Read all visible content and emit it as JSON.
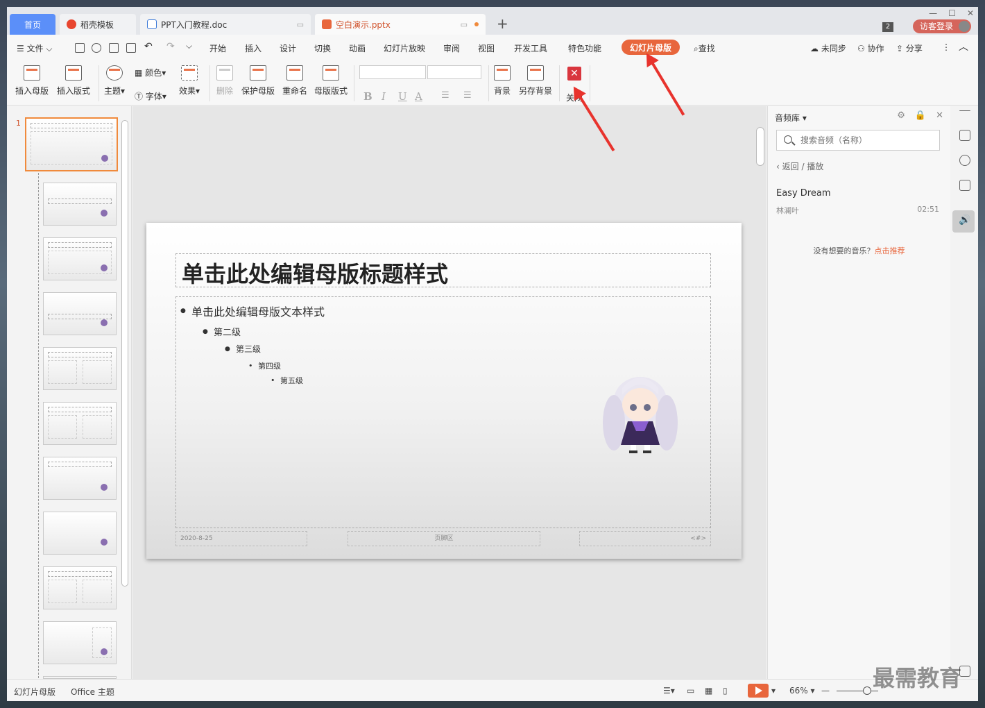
{
  "tabs": {
    "home": "首页",
    "t2": "稻壳模板",
    "t3": "PPT入门教程.doc",
    "t4": "空白演示.pptx",
    "win_count": "2",
    "login": "访客登录"
  },
  "menu": {
    "file": "文件",
    "items": [
      "开始",
      "插入",
      "设计",
      "切换",
      "动画",
      "幻灯片放映",
      "审阅",
      "视图",
      "开发工具",
      "特色功能"
    ],
    "active": "幻灯片母版",
    "search": "查找",
    "sync": "未同步",
    "collab": "协作",
    "share": "分享"
  },
  "ribbon": {
    "insert_master": "插入母版",
    "insert_layout": "插入版式",
    "theme": "主题",
    "color": "颜色",
    "font": "字体",
    "effect": "效果",
    "delete": "删除",
    "protect_master": "保护母版",
    "rename": "重命名",
    "master_layout": "母版版式",
    "background": "背景",
    "save_bg": "另存背景",
    "close": "关闭",
    "bold": "B",
    "italic": "I",
    "underline": "U",
    "fontcolor": "A"
  },
  "slide": {
    "number": "1",
    "title": "单击此处编辑母版标题样式",
    "l1": "单击此处编辑母版文本样式",
    "l2": "第二级",
    "l3": "第三级",
    "l4": "第四级",
    "l5": "第五级",
    "date": "2020-8-25",
    "footer": "页脚区",
    "pagenum": "<#>"
  },
  "audio": {
    "title": "音频库",
    "search_placeholder": "搜索音频（名称）",
    "back": "返回",
    "crumb_sep": "/",
    "crumb_cur": "播放",
    "song": "Easy Dream",
    "artist": "林澜叶",
    "duration": "02:51",
    "no_music": "没有想要的音乐？",
    "recommend": "点击推荐"
  },
  "status": {
    "mode": "幻灯片母版",
    "theme": "Office 主题",
    "zoom": "66%"
  },
  "watermark": "最需教育",
  "colors": {
    "accent": "#e8663c",
    "tab_home": "#5b8ff9",
    "close": "#d9363e"
  }
}
